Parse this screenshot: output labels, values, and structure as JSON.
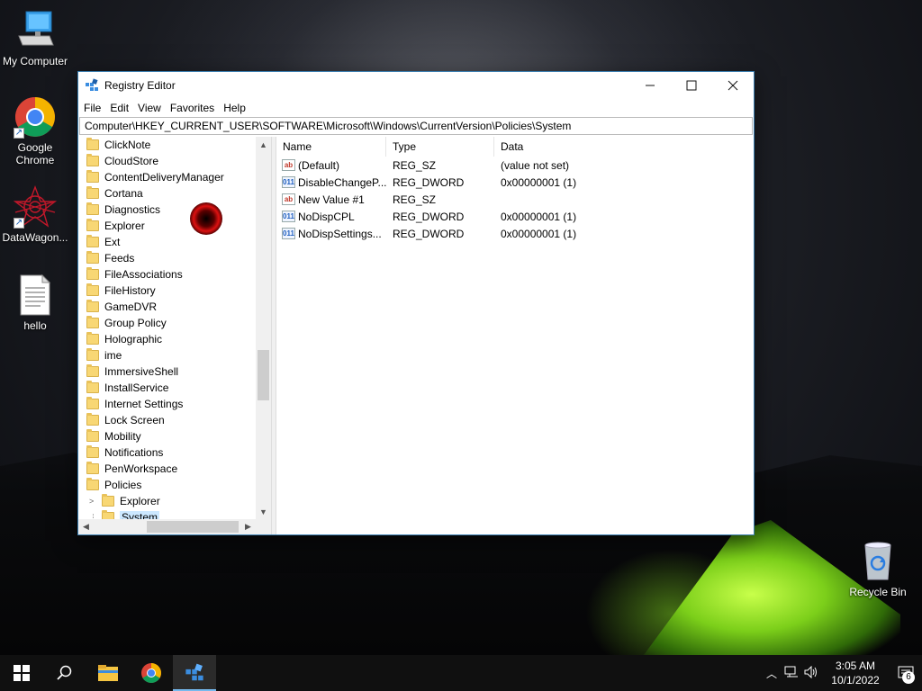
{
  "desktop": {
    "icons": [
      {
        "label": "My Computer",
        "icon": "computer-icon"
      },
      {
        "label": "Google Chrome",
        "icon": "chrome-icon"
      },
      {
        "label": "DataWagon...",
        "icon": "datawagon-icon"
      },
      {
        "label": "hello",
        "icon": "text-file-icon"
      },
      {
        "label": "Recycle Bin",
        "icon": "recycle-bin-icon"
      }
    ]
  },
  "window": {
    "title": "Registry Editor",
    "menu": [
      "File",
      "Edit",
      "View",
      "Favorites",
      "Help"
    ],
    "address": "Computer\\HKEY_CURRENT_USER\\SOFTWARE\\Microsoft\\Windows\\CurrentVersion\\Policies\\System",
    "tree": [
      "ClickNote",
      "CloudStore",
      "ContentDeliveryManager",
      "Cortana",
      "Diagnostics",
      "Explorer",
      "Ext",
      "Feeds",
      "FileAssociations",
      "FileHistory",
      "GameDVR",
      "Group Policy",
      "Holographic",
      "ime",
      "ImmersiveShell",
      "InstallService",
      "Internet Settings",
      "Lock Screen",
      "Mobility",
      "Notifications",
      "PenWorkspace",
      "Policies"
    ],
    "tree_children": [
      "Explorer",
      "System"
    ],
    "columns": {
      "name": "Name",
      "type": "Type",
      "data": "Data"
    },
    "values": [
      {
        "name": "(Default)",
        "type": "REG_SZ",
        "data": "(value not set)",
        "kind": "sz"
      },
      {
        "name": "DisableChangeP...",
        "type": "REG_DWORD",
        "data": "0x00000001 (1)",
        "kind": "dword"
      },
      {
        "name": "New Value #1",
        "type": "REG_SZ",
        "data": "",
        "kind": "sz"
      },
      {
        "name": "NoDispCPL",
        "type": "REG_DWORD",
        "data": "0x00000001 (1)",
        "kind": "dword"
      },
      {
        "name": "NoDispSettings...",
        "type": "REG_DWORD",
        "data": "0x00000001 (1)",
        "kind": "dword"
      }
    ]
  },
  "taskbar": {
    "time": "3:05 AM",
    "date": "10/1/2022",
    "notifications": "6"
  }
}
